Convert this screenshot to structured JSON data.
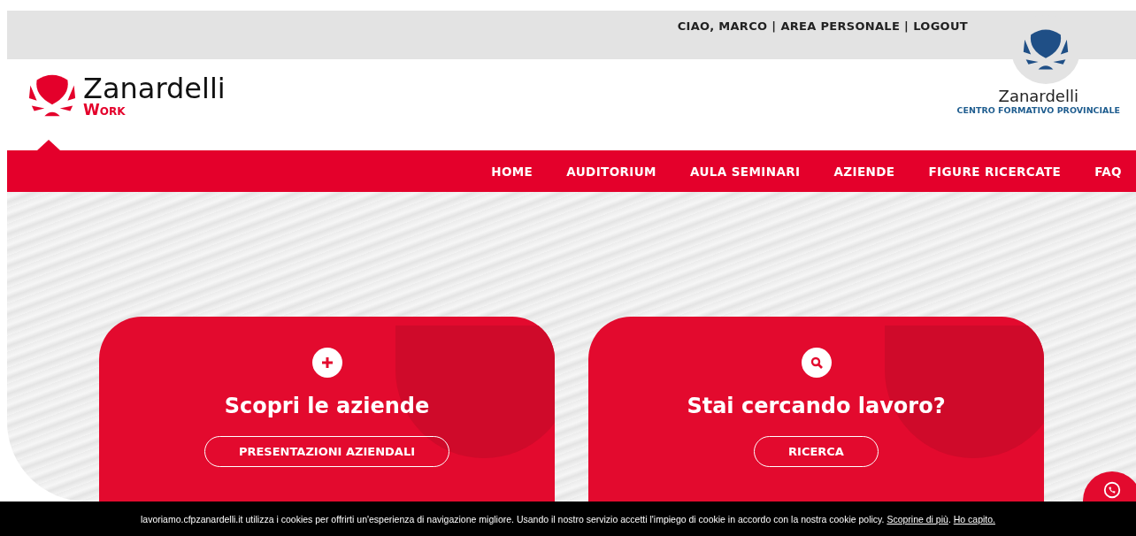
{
  "top_bar": {
    "links": [
      {
        "label": "CIAO, MARCO"
      },
      {
        "label": "AREA PERSONALE"
      },
      {
        "label": "LOGOUT"
      }
    ],
    "separator": "|"
  },
  "logo": {
    "name": "Zanardelli",
    "sub": "Work"
  },
  "partner_logo": {
    "name": "Zanardelli",
    "sub": "CENTRO FORMATIVO PROVINCIALE"
  },
  "nav": [
    "HOME",
    "AUDITORIUM",
    "AULA SEMINARI",
    "AZIENDE",
    "FIGURE RICERCATE",
    "FAQ"
  ],
  "cards": [
    {
      "kind": "plus",
      "title": "Scopri le aziende",
      "button": "PRESENTAZIONI AZIENDALI"
    },
    {
      "kind": "search",
      "title": "Stai cercando lavoro?",
      "button": "RICERCA"
    }
  ],
  "cookie_bar": {
    "text": "lavoriamo.cfpzanardelli.it utilizza i cookies per offrirti un'esperienza di navigazione migliore. Usando il nostro servizio accetti l'impiego di cookie in accordo con la nostra cookie policy.",
    "links": [
      "Scoprine di più",
      "Ho capito."
    ],
    "link_separator": "."
  }
}
